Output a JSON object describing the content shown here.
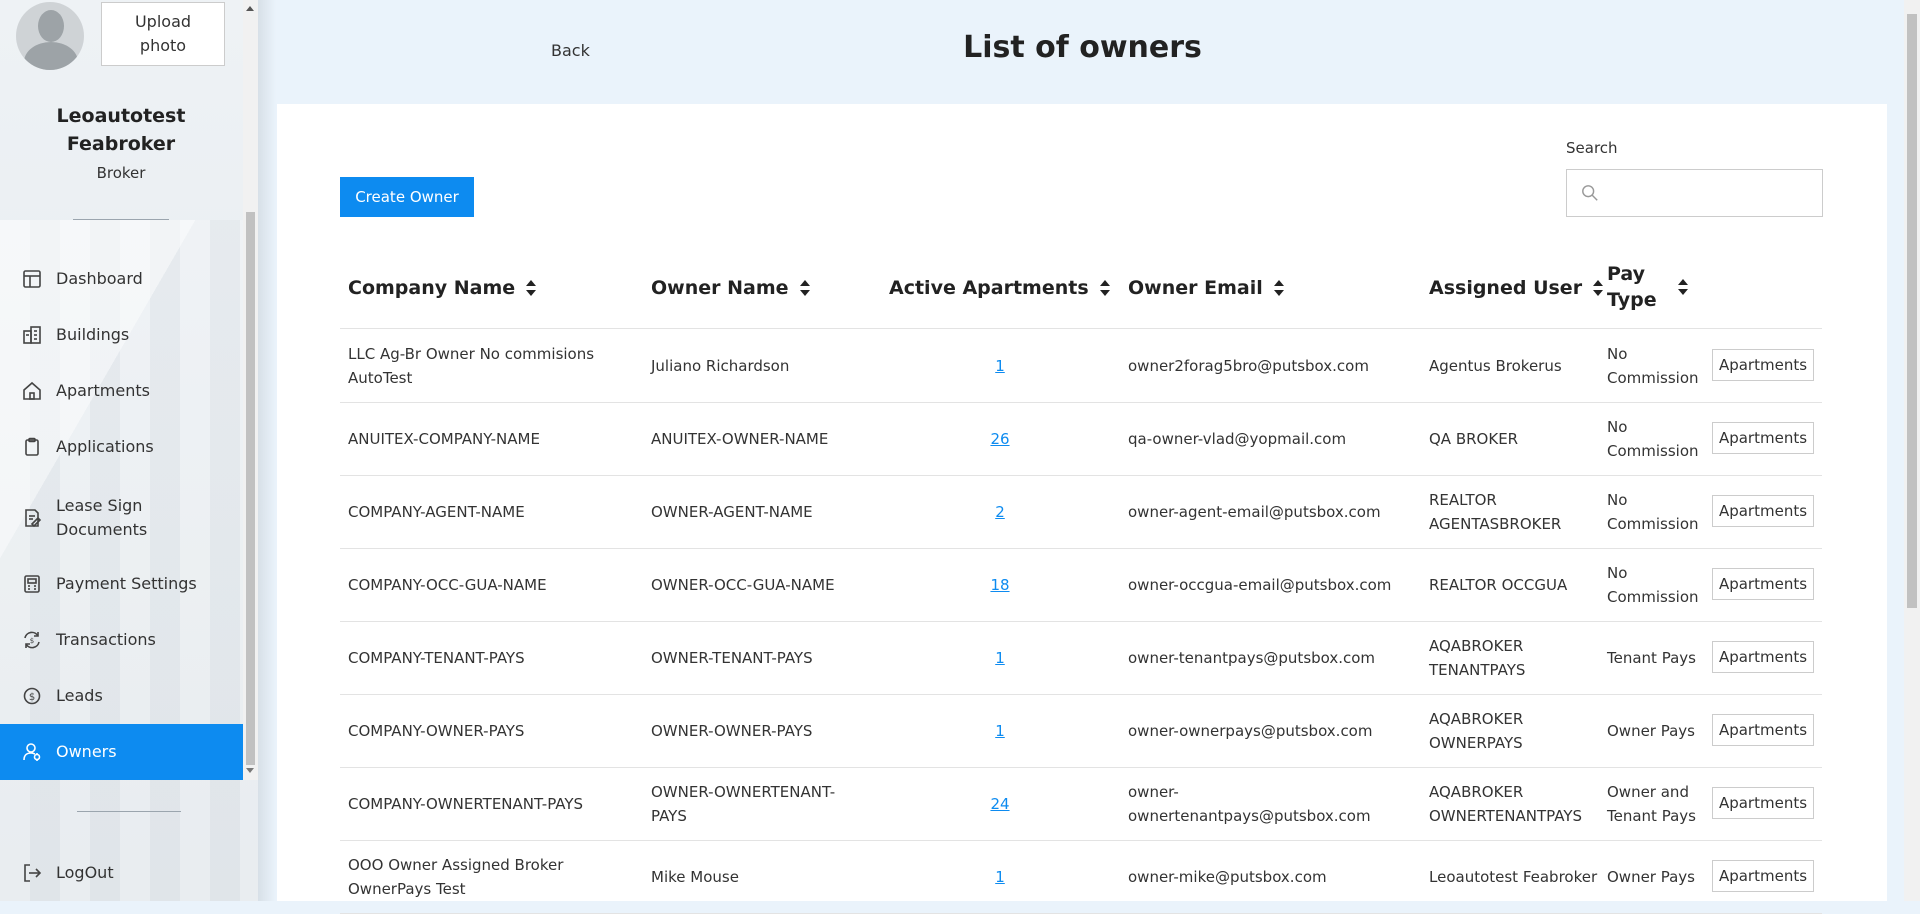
{
  "sidebar": {
    "upload_label": "Upload photo",
    "user_name": "Leoautotest Feabroker",
    "user_role": "Broker",
    "items": [
      {
        "label": "Dashboard",
        "icon": "dashboard-icon"
      },
      {
        "label": "Buildings",
        "icon": "buildings-icon"
      },
      {
        "label": "Apartments",
        "icon": "home-icon"
      },
      {
        "label": "Applications",
        "icon": "clipboard-icon"
      },
      {
        "label": "Lease Sign Documents",
        "icon": "document-sign-icon"
      },
      {
        "label": "Payment Settings",
        "icon": "payment-settings-icon"
      },
      {
        "label": "Transactions",
        "icon": "transactions-icon"
      },
      {
        "label": "Leads",
        "icon": "leads-icon"
      },
      {
        "label": "Owners",
        "icon": "owners-icon",
        "active": true
      }
    ],
    "logout_label": "LogOut",
    "accent": "#0d8bf0"
  },
  "header": {
    "back_label": "Back",
    "title": "List of owners"
  },
  "toolbar": {
    "create_label": "Create Owner",
    "search_label": "Search",
    "search_value": ""
  },
  "table": {
    "columns": [
      "Company Name",
      "Owner Name",
      "Active Apartments",
      "Owner Email",
      "Assigned User",
      "Pay Type"
    ],
    "rows": [
      {
        "company": "LLC Ag-Br Owner No commisions AutoTest",
        "owner": "Juliano Richardson",
        "active": "1",
        "email": "owner2forag5bro@putsbox.com",
        "user": "Agentus Brokerus",
        "pay": "No Commission",
        "action": "Apartments"
      },
      {
        "company": "ANUITEX-COMPANY-NAME",
        "owner": "ANUITEX-OWNER-NAME",
        "active": "26",
        "email": "qa-owner-vlad@yopmail.com",
        "user": "QA BROKER",
        "pay": "No Commission",
        "action": "Apartments"
      },
      {
        "company": "COMPANY-AGENT-NAME",
        "owner": "OWNER-AGENT-NAME",
        "active": "2",
        "email": "owner-agent-email@putsbox.com",
        "user": "REALTOR AGENTASBROKER",
        "pay": "No Commission",
        "action": "Apartments"
      },
      {
        "company": "COMPANY-OCC-GUA-NAME",
        "owner": "OWNER-OCC-GUA-NAME",
        "active": "18",
        "email": "owner-occgua-email@putsbox.com",
        "user": "REALTOR OCCGUA",
        "pay": "No Commission",
        "action": "Apartments"
      },
      {
        "company": "COMPANY-TENANT-PAYS",
        "owner": "OWNER-TENANT-PAYS",
        "active": "1",
        "email": "owner-tenantpays@putsbox.com",
        "user": "AQABROKER TENANTPAYS",
        "pay": "Tenant Pays",
        "action": "Apartments"
      },
      {
        "company": "COMPANY-OWNER-PAYS",
        "owner": "OWNER-OWNER-PAYS",
        "active": "1",
        "email": "owner-ownerpays@putsbox.com",
        "user": "AQABROKER OWNERPAYS",
        "pay": "Owner Pays",
        "action": "Apartments"
      },
      {
        "company": "COMPANY-OWNERTENANT-PAYS",
        "owner": "OWNER-OWNERTENANT-PAYS",
        "active": "24",
        "email": "owner-ownertenantpays@putsbox.com",
        "user": "AQABROKER OWNERTENANTPAYS",
        "pay": "Owner and Tenant Pays",
        "action": "Apartments"
      },
      {
        "company": "OOO Owner Assigned Broker OwnerPays Test",
        "owner": "Mike Mouse",
        "active": "1",
        "email": "owner-mike@putsbox.com",
        "user": "Leoautotest Feabroker",
        "pay": "Owner Pays",
        "action": "Apartments"
      }
    ]
  }
}
